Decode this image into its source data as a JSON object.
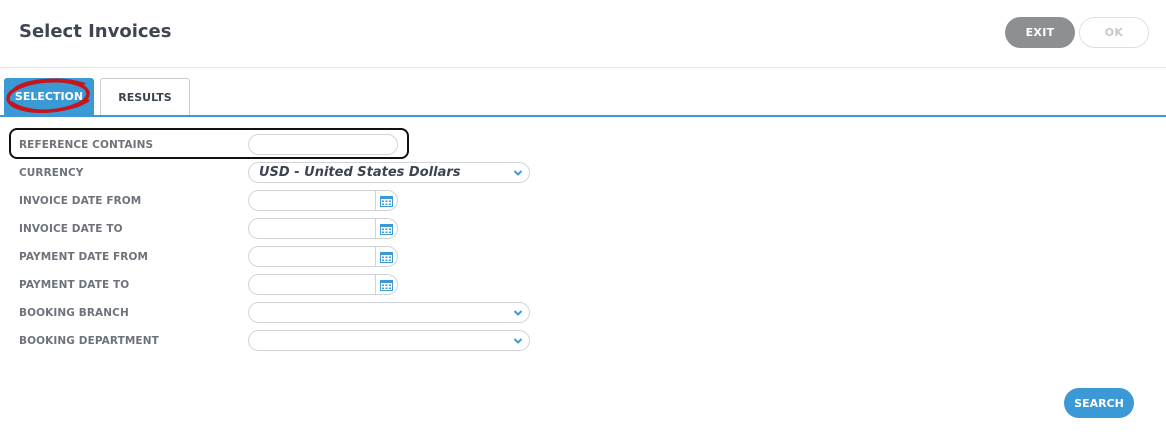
{
  "header": {
    "title": "Select Invoices",
    "exit_label": "EXIT",
    "ok_label": "OK"
  },
  "tabs": [
    {
      "label": "SELECTION",
      "active": true
    },
    {
      "label": "RESULTS",
      "active": false
    }
  ],
  "form": {
    "reference_contains": {
      "label": "REFERENCE CONTAINS",
      "value": ""
    },
    "currency": {
      "label": "CURRENCY",
      "value": "USD - United States Dollars"
    },
    "invoice_date_from": {
      "label": "INVOICE DATE FROM",
      "value": ""
    },
    "invoice_date_to": {
      "label": "INVOICE DATE TO",
      "value": ""
    },
    "payment_date_from": {
      "label": "PAYMENT DATE FROM",
      "value": ""
    },
    "payment_date_to": {
      "label": "PAYMENT DATE TO",
      "value": ""
    },
    "booking_branch": {
      "label": "BOOKING BRANCH",
      "value": ""
    },
    "booking_department": {
      "label": "BOOKING DEPARTMENT",
      "value": ""
    }
  },
  "search_label": "SEARCH",
  "colors": {
    "accent": "#3b99d6",
    "exit_bg": "#8d9093",
    "annotation_red": "#c4161c"
  }
}
